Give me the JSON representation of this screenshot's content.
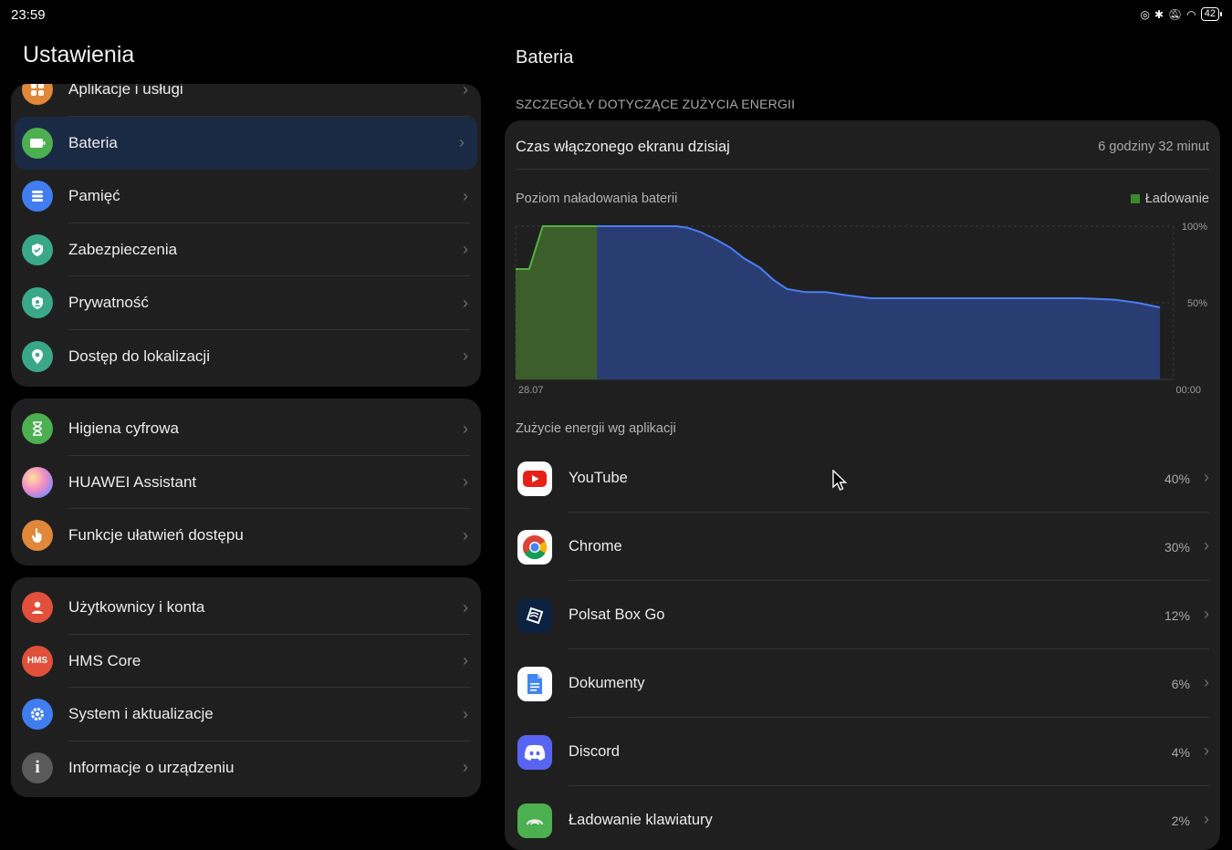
{
  "status": {
    "time": "23:59",
    "battery": "42"
  },
  "left": {
    "title": "Ustawienia",
    "groups": [
      {
        "items": [
          {
            "label": "Aplikacje i usługi",
            "icon": "apps-icon",
            "color": "#e0873a"
          },
          {
            "label": "Bateria",
            "icon": "battery-icon",
            "color": "#4caf50",
            "selected": true
          },
          {
            "label": "Pamięć",
            "icon": "storage-icon",
            "color": "#3f7df0"
          },
          {
            "label": "Zabezpieczenia",
            "icon": "shield-icon",
            "color": "#3aa888"
          },
          {
            "label": "Prywatność",
            "icon": "privacy-icon",
            "color": "#3aa888"
          },
          {
            "label": "Dostęp do lokalizacji",
            "icon": "location-icon",
            "color": "#3aa888"
          }
        ]
      },
      {
        "items": [
          {
            "label": "Higiena cyfrowa",
            "icon": "hourglass-icon",
            "color": "#4caf50"
          },
          {
            "label": "HUAWEI Assistant",
            "icon": "assistant-icon",
            "color": "#c47cd8"
          },
          {
            "label": "Funkcje ułatwień dostępu",
            "icon": "hand-icon",
            "color": "#e0873a"
          }
        ]
      },
      {
        "items": [
          {
            "label": "Użytkownicy i konta",
            "icon": "user-icon",
            "color": "#e0503a"
          },
          {
            "label": "HMS Core",
            "icon": "hms-icon",
            "color": "#e0503a",
            "glyph": "HMS"
          },
          {
            "label": "System i aktualizacje",
            "icon": "gear-icon",
            "color": "#3f7df0"
          },
          {
            "label": "Informacje o urządzeniu",
            "icon": "info-icon",
            "color": "#5a5a5a",
            "glyph": "i"
          }
        ]
      }
    ]
  },
  "right": {
    "title": "Bateria",
    "section_header": "SZCZEGÓŁY DOTYCZĄCE ZUŻYCIA ENERGII",
    "screen_time_label": "Czas włączonego ekranu dzisiaj",
    "screen_time_value": "6 godziny 32 minut",
    "chart_title": "Poziom naładowania baterii",
    "legend_label": "Ładowanie",
    "apps_title": "Zużycie energii wg aplikacji",
    "apps": [
      {
        "name": "YouTube",
        "pct": "40%",
        "icon": "youtube-icon"
      },
      {
        "name": "Chrome",
        "pct": "30%",
        "icon": "chrome-icon"
      },
      {
        "name": "Polsat Box Go",
        "pct": "12%",
        "icon": "polsat-icon"
      },
      {
        "name": "Dokumenty",
        "pct": "6%",
        "icon": "docs-icon"
      },
      {
        "name": "Discord",
        "pct": "4%",
        "icon": "discord-icon"
      },
      {
        "name": "Ładowanie klawiatury",
        "pct": "2%",
        "icon": "keyboard-icon"
      }
    ]
  },
  "chart_data": {
    "type": "area",
    "title": "Poziom naładowania baterii",
    "x_tick_labels": [
      "28.07",
      "00:00"
    ],
    "y_tick_labels": [
      "100%",
      "50%"
    ],
    "ylim": [
      0,
      100
    ],
    "x_unit": "hours since 00:00 on 28.07",
    "x": [
      0,
      0.6,
      1.2,
      3.6,
      7.1,
      7.6,
      8.2,
      8.9,
      9.5,
      10.1,
      10.8,
      11.4,
      12.0,
      12.8,
      13.7,
      14.6,
      15.7,
      23.9,
      24.0,
      24.5,
      25.0,
      26.5,
      27.5,
      28.5
    ],
    "y": [
      72,
      72,
      100,
      100,
      100,
      99,
      96,
      91,
      86,
      79,
      73,
      65,
      59,
      57,
      57,
      55,
      53,
      53,
      53,
      53,
      53,
      52,
      50,
      47
    ],
    "charging_ranges": [
      [
        0,
        3.6
      ]
    ],
    "xlim": [
      0,
      29.1
    ],
    "legend": [
      {
        "name": "Ładowanie",
        "color": "#3a8a2a"
      }
    ],
    "colors": {
      "discharge_fill": "#2a3f78",
      "discharge_line": "#4d7cf0",
      "charge_fill": "#3b5e2a",
      "charge_line": "#55b040"
    },
    "grid": true
  }
}
